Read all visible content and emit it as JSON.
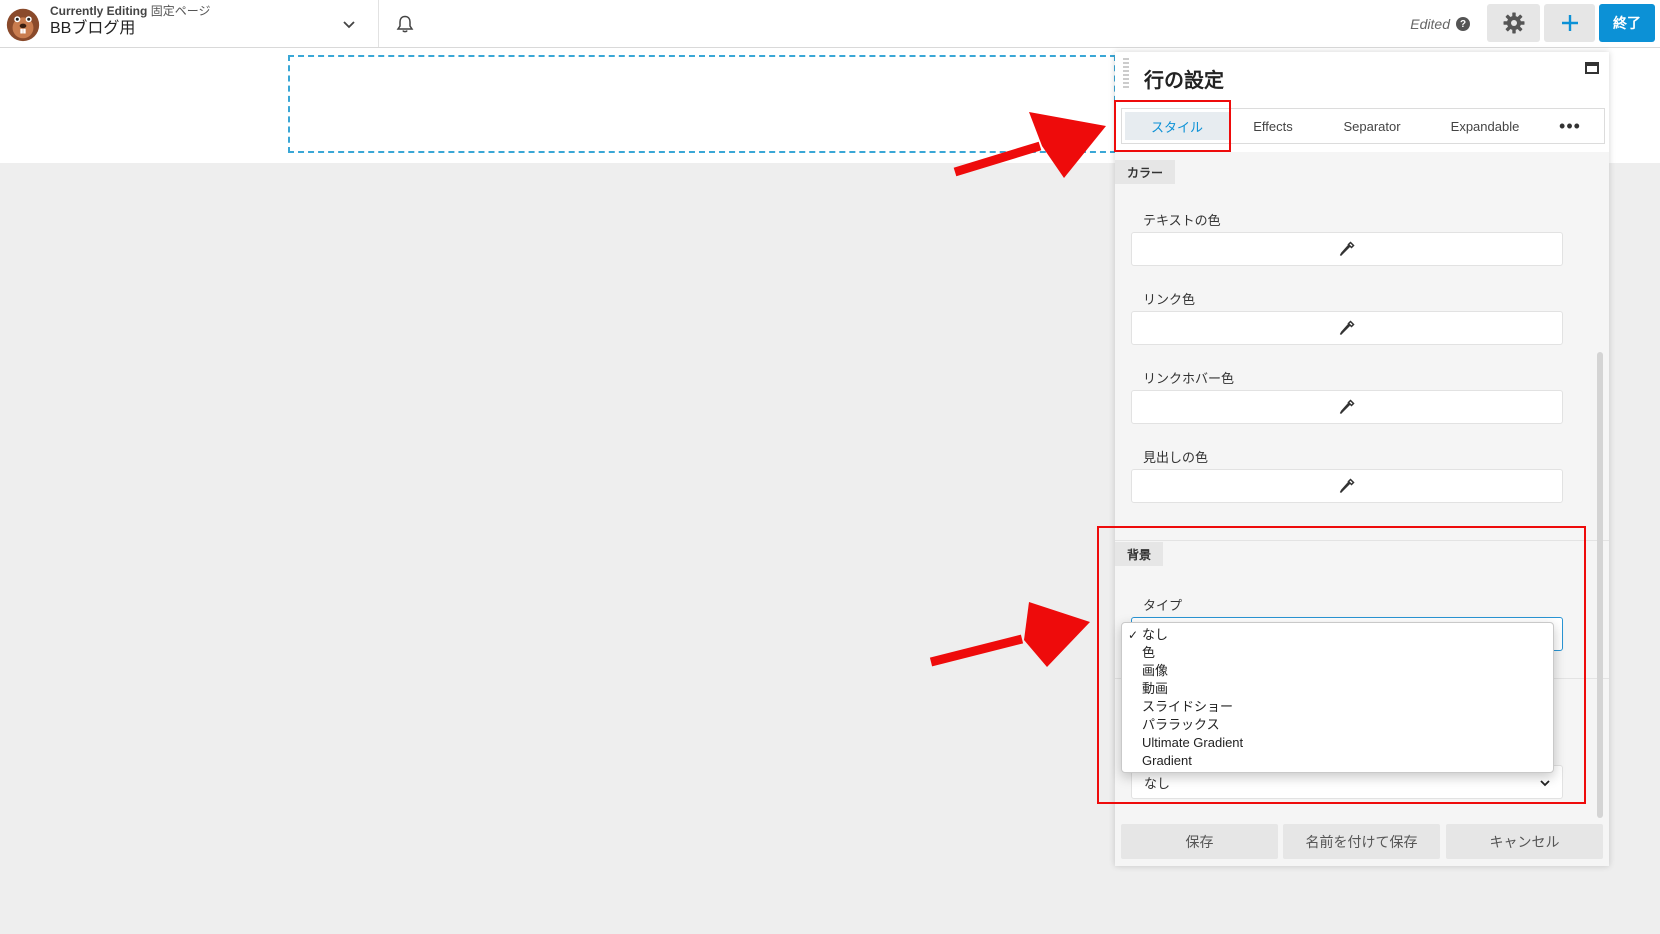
{
  "topbar": {
    "currently_editing_label": "Currently Editing",
    "page_type": "固定ページ",
    "page_title": "BBブログ用",
    "status": "Edited",
    "help_glyph": "?",
    "done_label": "終了",
    "icons": [
      "beaver-logo-icon",
      "chevron-down-icon",
      "bell-icon",
      "help-icon",
      "gear-icon",
      "plus-icon"
    ]
  },
  "panel": {
    "title": "行の設定",
    "tabs": [
      {
        "label": "スタイル",
        "active": true
      },
      {
        "label": "Effects"
      },
      {
        "label": "Separator"
      },
      {
        "label": "Expandable"
      },
      {
        "label": "•••"
      }
    ],
    "color_section": {
      "label": "カラー",
      "fields": [
        {
          "label": "テキストの色"
        },
        {
          "label": "リンク色"
        },
        {
          "label": "リンクホバー色"
        },
        {
          "label": "見出しの色"
        }
      ]
    },
    "background_section": {
      "label": "背景",
      "type_label": "タイプ",
      "options": [
        "なし",
        "色",
        "画像",
        "動画",
        "スライドショー",
        "パララックス",
        "Ultimate Gradient",
        "Gradient"
      ],
      "selected": "なし",
      "lower_select_value": "なし"
    },
    "footer": {
      "save": "保存",
      "save_as": "名前を付けて保存",
      "cancel": "キャンセル"
    }
  },
  "colors": {
    "accent": "#0c91d6",
    "annotation": "#ee0b0b",
    "canvas_bg": "#eeeeee"
  }
}
